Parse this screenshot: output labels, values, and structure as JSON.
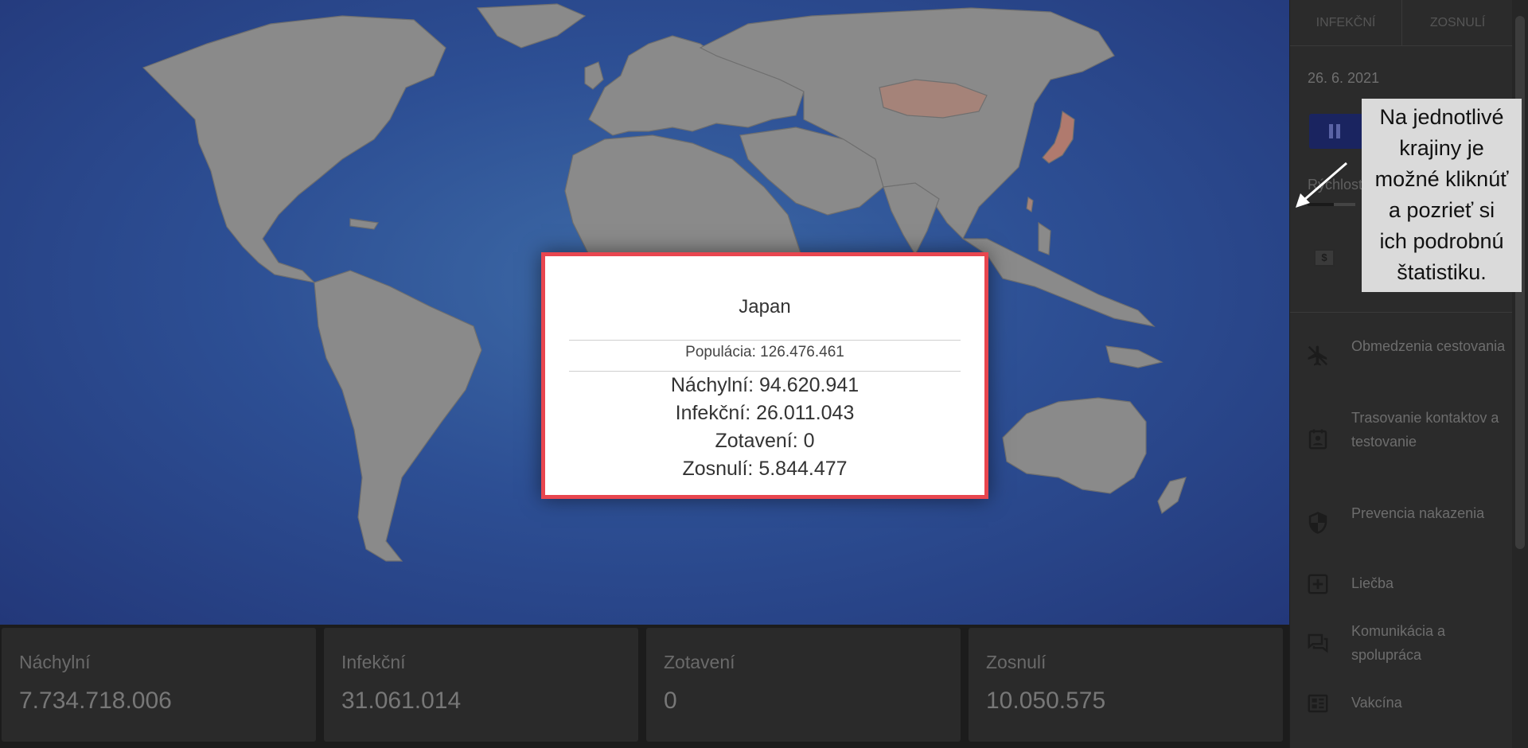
{
  "tabs": [
    "Infekční",
    "Zosnulí"
  ],
  "date": "26. 6. 2021",
  "speed_label": "Rýchlosť",
  "speed_fraction": 0.55,
  "money_icon_symbol": "$",
  "menu": [
    {
      "label": "Obmedzenia cestovania",
      "icon": "airplane-off-icon"
    },
    {
      "label": "Trasovanie kontaktov a testovanie",
      "icon": "contact-tracing-icon"
    },
    {
      "label": "Prevencia nakazenia",
      "icon": "shield-icon"
    },
    {
      "label": "Liečba",
      "icon": "medical-plus-icon"
    },
    {
      "label": "Komunikácia a spolupráca",
      "icon": "chat-icon"
    },
    {
      "label": "Vakcína",
      "icon": "vaccine-icon"
    }
  ],
  "stats": [
    {
      "label": "Náchylní",
      "value": "7.734.718.006"
    },
    {
      "label": "Infekční",
      "value": "31.061.014"
    },
    {
      "label": "Zotavení",
      "value": "0"
    },
    {
      "label": "Zosnulí",
      "value": "10.050.575"
    }
  ],
  "popup": {
    "country": "Japan",
    "population": "Populácia: 126.476.461",
    "rows": [
      "Náchylní: 94.620.941",
      "Infekční: 26.011.043",
      "Zotavení: 0",
      "Zosnulí: 5.844.477"
    ]
  },
  "callout": {
    "lines": [
      "Na jednotlivé",
      "krajiny je",
      "možné kliknúť",
      "a pozrieť si",
      "ich podrobnú",
      "štatistiku."
    ]
  },
  "colors": {
    "ocean": "#2d4f94",
    "land": "#8a8a8a",
    "highlight_country": "#b07a6e",
    "popup_border": "#e8464f",
    "play_button": "#1a2460"
  }
}
